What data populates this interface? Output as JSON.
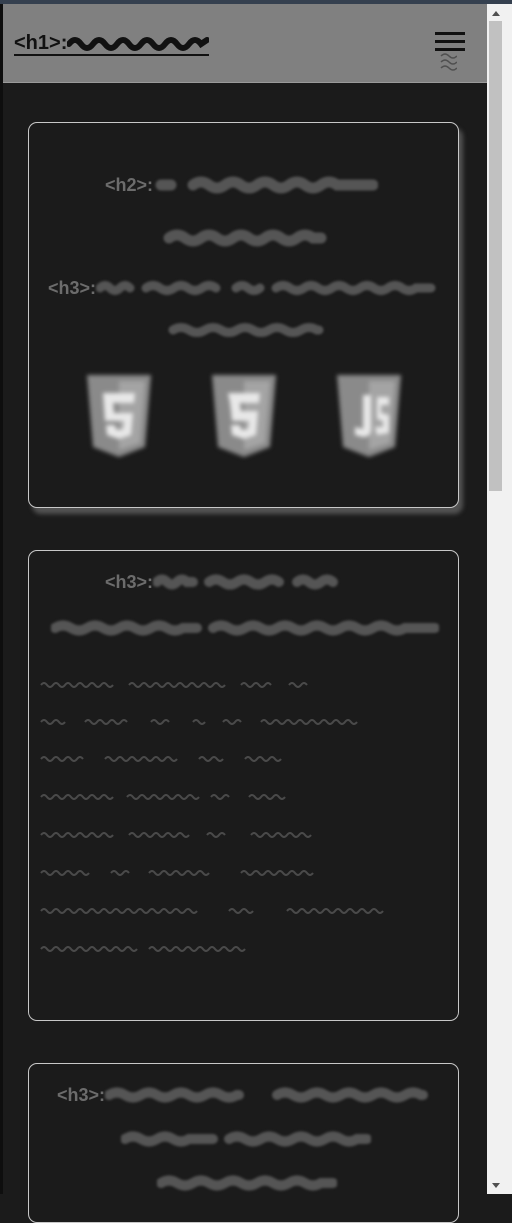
{
  "header": {
    "h1_tag": "<h1>:",
    "menu_icon": "hamburger-menu-icon"
  },
  "card1": {
    "h2_tag": "<h2>:",
    "h3_tag": "<h3>:",
    "logos": [
      "html5-logo",
      "css3-logo",
      "javascript-logo"
    ]
  },
  "card2": {
    "h3_tag": "<h3>:"
  },
  "card3": {
    "h3_tag": "<h3>:"
  },
  "colors": {
    "background": "#1b1b1b",
    "header": "#808080",
    "card_border": "#c8c8c8",
    "redacted_text": "#555555"
  }
}
